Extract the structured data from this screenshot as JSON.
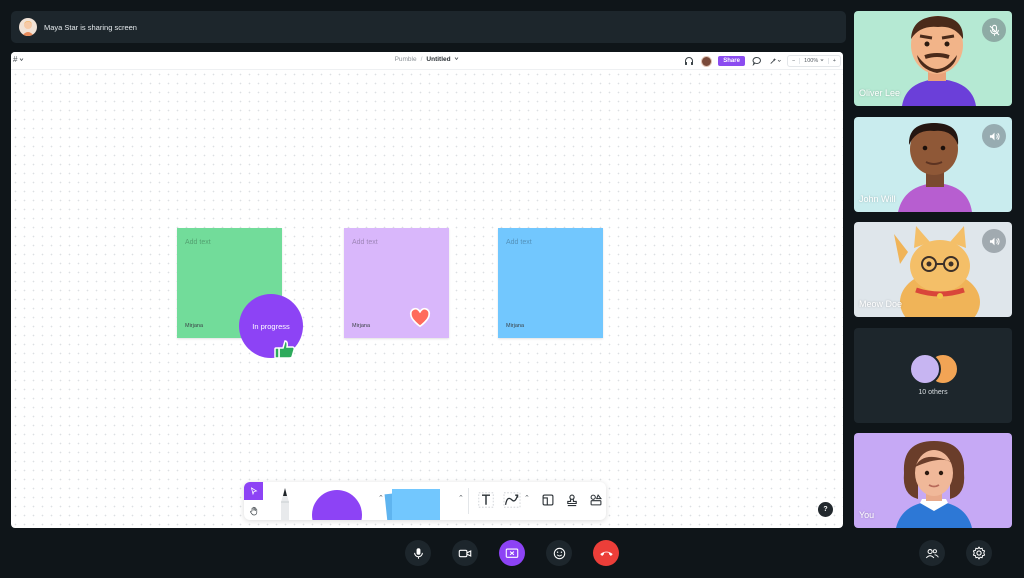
{
  "banner": {
    "text": "Maya Star is sharing screen"
  },
  "board": {
    "breadcrumb_workspace": "Pumble",
    "breadcrumb_separator": "/",
    "doc_title": "Untitled",
    "share_label": "Share",
    "zoom_minus": "−",
    "zoom_value": "100%",
    "zoom_plus": "+",
    "stickies": [
      {
        "placeholder": "Add text",
        "author": "Mirjana",
        "color": "#72dc9a"
      },
      {
        "placeholder": "Add text",
        "author": "Mirjana",
        "color": "#d9b7fb"
      },
      {
        "placeholder": "Add text",
        "author": "Mirjana",
        "color": "#72c7fe"
      }
    ],
    "progress_label": "In progress",
    "help_label": "?"
  },
  "participants": [
    {
      "name": "Oliver Lee",
      "status_icon": "mic-off-icon"
    },
    {
      "name": "John Will",
      "status_icon": "speaker-icon"
    },
    {
      "name": "Meow Doe",
      "status_icon": "speaker-icon"
    },
    {
      "name": "10 others"
    },
    {
      "name": "You"
    }
  ],
  "colors": {
    "accent": "#8d43f5",
    "hangup": "#ec3e39",
    "background": "#0f1519",
    "panel": "#1d262c"
  }
}
